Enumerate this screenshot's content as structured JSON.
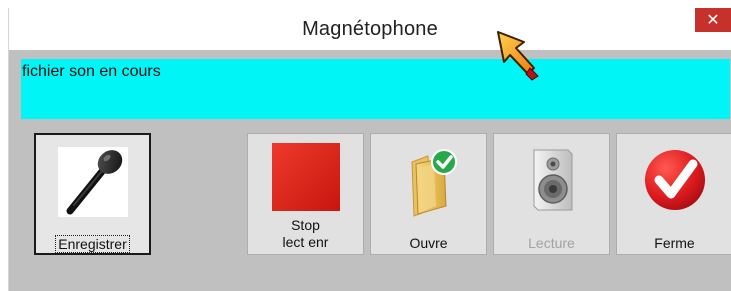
{
  "window": {
    "title": "Magnétophone",
    "close_glyph": "✕"
  },
  "status": {
    "text": "fichier son en cours",
    "background": "#00f6f6"
  },
  "buttons": [
    {
      "id": "enregistrer",
      "line1": "Enregistrer",
      "line2": "",
      "icon": "microphone-icon",
      "focused": true,
      "enabled": true
    },
    {
      "id": "stop",
      "line1": "Stop",
      "line2": "lect enr",
      "icon": "stop-square-icon",
      "enabled": true
    },
    {
      "id": "ouvre",
      "line1": "Ouvre",
      "line2": "",
      "icon": "folder-check-icon",
      "enabled": true
    },
    {
      "id": "lecture",
      "line1": "Lecture",
      "line2": "",
      "icon": "speaker-icon",
      "enabled": false
    },
    {
      "id": "ferme",
      "line1": "Ferme",
      "line2": "",
      "icon": "red-check-icon",
      "enabled": true
    }
  ],
  "colors": {
    "client_bg": "#c0c0c0",
    "close_red": "#c7312b",
    "stop_red": "#e02b1f",
    "check_red": "#d8141b"
  }
}
